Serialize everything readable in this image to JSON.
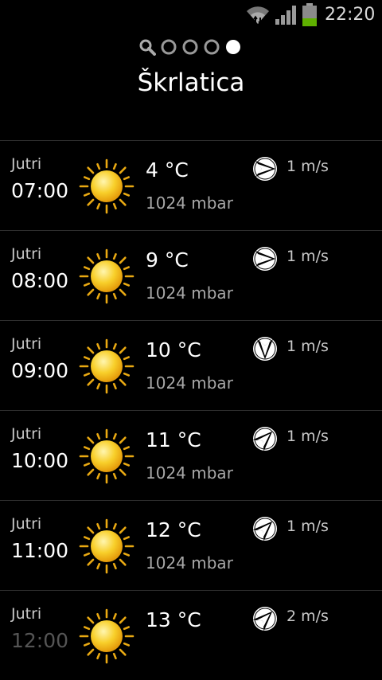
{
  "status": {
    "time": "22:20",
    "icons": [
      "wifi-icon",
      "signal-icon",
      "battery-icon"
    ]
  },
  "pager": {
    "pages": 5,
    "active": 4,
    "first_icon": "search-icon"
  },
  "location": {
    "title": "Škrlatica"
  },
  "forecast": [
    {
      "day": "Jutri",
      "time": "07:00",
      "icon": "sun-icon",
      "temp": "4 °C",
      "pressure": "1024 mbar",
      "wind_dir": "east",
      "wind": "1 m/s"
    },
    {
      "day": "Jutri",
      "time": "08:00",
      "icon": "sun-icon",
      "temp": "9 °C",
      "pressure": "1024 mbar",
      "wind_dir": "east",
      "wind": "1 m/s"
    },
    {
      "day": "Jutri",
      "time": "09:00",
      "icon": "sun-icon",
      "temp": "10 °C",
      "pressure": "1024 mbar",
      "wind_dir": "south",
      "wind": "1 m/s"
    },
    {
      "day": "Jutri",
      "time": "10:00",
      "icon": "sun-icon",
      "temp": "11 °C",
      "pressure": "1024 mbar",
      "wind_dir": "northeast",
      "wind": "1 m/s"
    },
    {
      "day": "Jutri",
      "time": "11:00",
      "icon": "sun-icon",
      "temp": "12 °C",
      "pressure": "1024 mbar",
      "wind_dir": "northeast",
      "wind": "1 m/s"
    },
    {
      "day": "Jutri",
      "time": "12:00",
      "icon": "sun-icon",
      "temp": "13 °C",
      "pressure": "",
      "wind_dir": "northeast",
      "wind": "2 m/s"
    }
  ],
  "colors": {
    "background": "#000000",
    "sun": "#f5c21a",
    "battery": "#5fb000"
  }
}
